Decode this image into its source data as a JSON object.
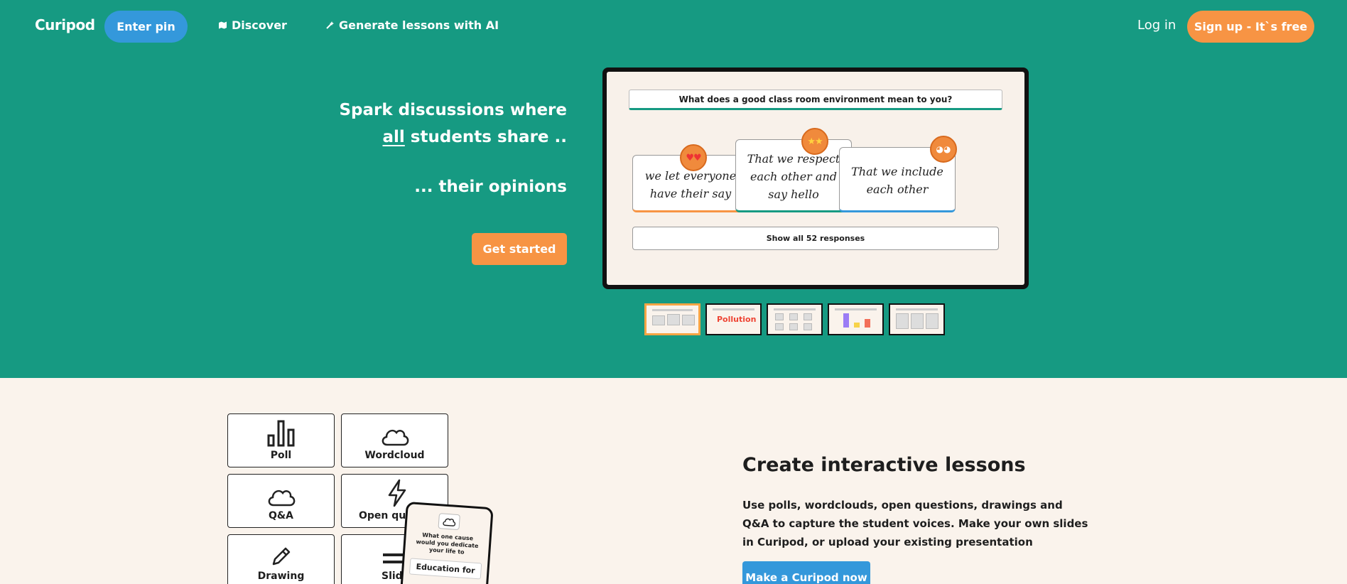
{
  "nav": {
    "logo": "Curipod",
    "enter_pin": "Enter pin",
    "discover": "Discover",
    "generate": "Generate lessons with AI",
    "login": "Log in",
    "signup": "Sign up - It`s free"
  },
  "hero": {
    "line1": "Spark discussions where",
    "line2_underlined": "all",
    "line2_rest": " students share ..",
    "line3": "... their opinions",
    "cta": "Get started"
  },
  "preview": {
    "question": "What does a good class room environment mean to you?",
    "responses": [
      "we let everyone have their say",
      "That we respect each other and say hello",
      "That we include each other"
    ],
    "show_all": "Show all 52 responses",
    "thumb_2_text": "Pollution",
    "active_thumb": 1
  },
  "features": {
    "tiles": [
      {
        "label": "Poll",
        "icon": "bar-chart-icon"
      },
      {
        "label": "Wordcloud",
        "icon": "cloud-icon"
      },
      {
        "label": "Q&A",
        "icon": "cloud-icon"
      },
      {
        "label": "Open questions",
        "icon": "lightning-icon"
      },
      {
        "label": "Drawing",
        "icon": "pencil-icon"
      },
      {
        "label": "Slides",
        "icon": "slides-icon"
      }
    ],
    "phone": {
      "question": "What one cause would you dedicate your life to",
      "answer": "Education for"
    },
    "title": "Create interactive lessons",
    "body": "Use polls, wordclouds, open questions, drawings and Q&A to capture the student voices. Make your own slides in Curipod, or upload your existing presentation",
    "cta": "Make a Curipod now"
  },
  "colors": {
    "hero_bg": "#169a82",
    "accent_orange": "#f79444",
    "accent_blue": "#3498db",
    "page_bg": "#faf3ec"
  }
}
